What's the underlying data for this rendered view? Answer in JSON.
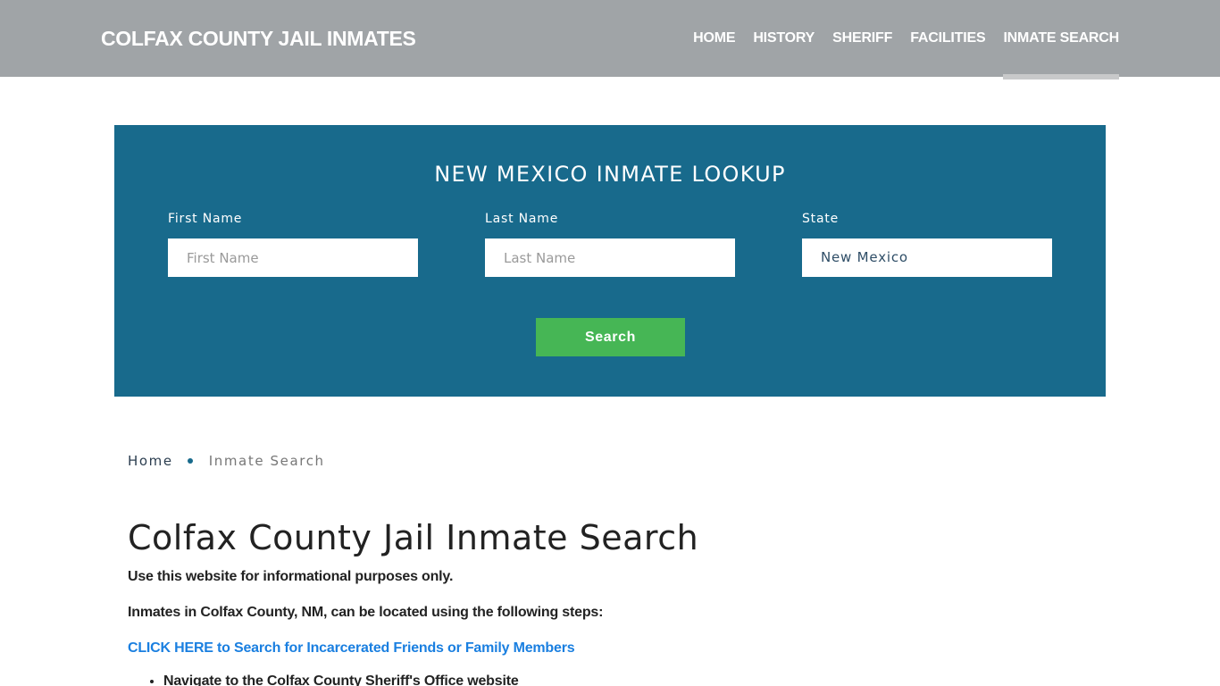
{
  "header": {
    "brand": "COLFAX COUNTY JAIL INMATES",
    "nav": [
      {
        "label": "HOME",
        "active": false
      },
      {
        "label": "HISTORY",
        "active": false
      },
      {
        "label": "SHERIFF",
        "active": false
      },
      {
        "label": "FACILITIES",
        "active": false
      },
      {
        "label": "INMATE SEARCH",
        "active": true
      }
    ]
  },
  "lookup": {
    "title": "NEW MEXICO INMATE LOOKUP",
    "first_name": {
      "label": "First Name",
      "placeholder": "First Name",
      "value": ""
    },
    "last_name": {
      "label": "Last Name",
      "placeholder": "Last Name",
      "value": ""
    },
    "state": {
      "label": "State",
      "value": "New Mexico"
    },
    "search_label": "Search"
  },
  "breadcrumb": {
    "home": "Home",
    "current": "Inmate Search"
  },
  "content": {
    "title": "Colfax County Jail Inmate Search",
    "p1": "Use this website for informational purposes only.",
    "p2": "Inmates in Colfax County, NM, can be located using the following steps:",
    "cta": "CLICK HERE to Search for Incarcerated Friends or Family Members",
    "steps": [
      "Navigate to the Colfax County Sheriff's Office website"
    ]
  },
  "colors": {
    "navbar": "#a0a4a7",
    "lookup_bg": "#186a8c",
    "search_button": "#46b655",
    "link": "#1a7fe0"
  }
}
